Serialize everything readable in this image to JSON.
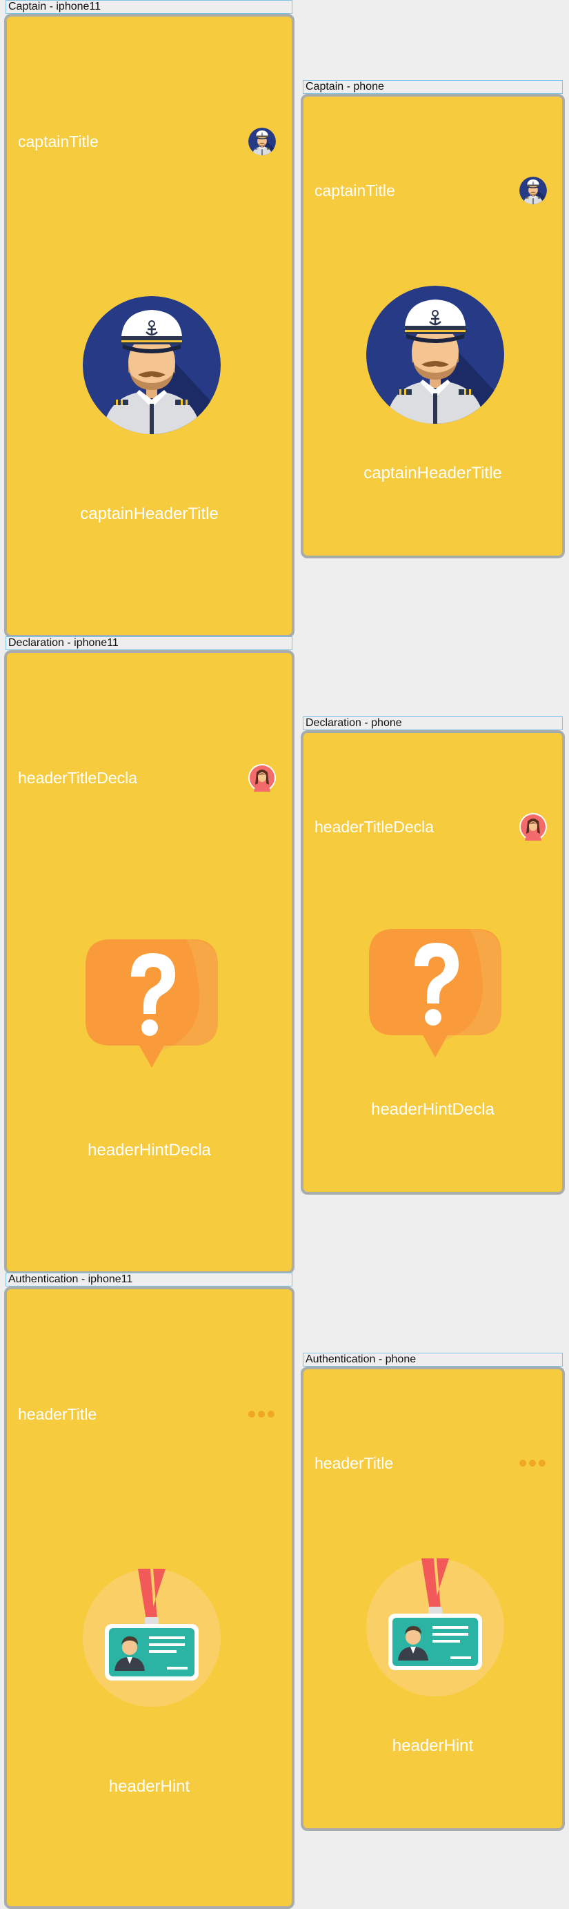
{
  "frames": {
    "captain_iphone11": {
      "label": "Captain - iphone11",
      "title": "captainTitle",
      "header": "captainHeaderTitle"
    },
    "captain_phone": {
      "label": "Captain - phone",
      "title": "captainTitle",
      "header": "captainHeaderTitle"
    },
    "declaration_iphone11": {
      "label": "Declaration - iphone11",
      "title": "headerTitleDecla",
      "header": "headerHintDecla"
    },
    "declaration_phone": {
      "label": "Declaration - phone",
      "title": "headerTitleDecla",
      "header": "headerHintDecla"
    },
    "authentication_iphone11": {
      "label": "Authentication - iphone11",
      "title": "headerTitle",
      "header": "headerHint"
    },
    "authentication_phone": {
      "label": "Authentication - phone",
      "title": "headerTitle",
      "header": "headerHint"
    }
  },
  "colors": {
    "canvas": "#eeeeee",
    "screen_background": "#f6cb3e",
    "screen_border": "#a8acac",
    "label_border": "#7fc4e8",
    "text": "#ffffff"
  },
  "icons": {
    "captain": "captain-avatar-icon",
    "declaration_small": "woman-avatar-icon",
    "declaration_big": "question-bubble-icon",
    "authentication_small": "loading-dots-icon",
    "authentication_big": "id-badge-icon"
  }
}
